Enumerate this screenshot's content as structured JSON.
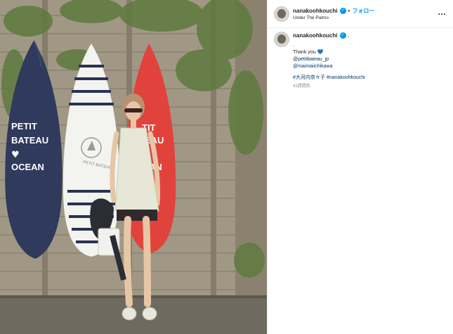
{
  "post": {
    "username": "nanakoohkouchi",
    "follow_label": "フォロー",
    "location": "Under The Palmo",
    "more_label": "…"
  },
  "caption": {
    "username": "nanakoohkouchi",
    "trailing_dot": ".",
    "line_dot": ".",
    "thank_you": "Thank you",
    "heart": "💙",
    "mention1": "@petitbateau_jp",
    "mention2": "@maimaiichikawa",
    "hashtag1": "#大河内奈々子",
    "hashtag2": "#nanakoohkouchi",
    "time": "43週間前"
  },
  "photo": {
    "board_left_text": [
      "PETIT",
      "BATEAU",
      "♥",
      "OCEAN"
    ],
    "board_mid_text": "PETIT BATEAU",
    "board_right_text": [
      "TIT",
      "EAU",
      "AN"
    ],
    "colors": {
      "navy": "#2f3a5c",
      "red": "#e2423c",
      "white": "#f3f3f0",
      "wood": "#9a927f"
    }
  },
  "colors": {
    "accent": "#0095f6",
    "link": "#00376b",
    "muted": "#8e8e8e"
  }
}
